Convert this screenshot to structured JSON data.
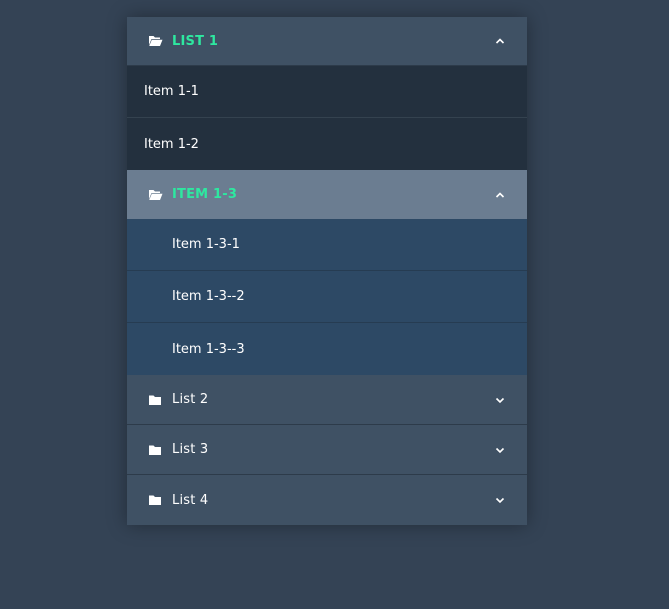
{
  "colors": {
    "background": "#344355",
    "header": "#3f5164",
    "header_active": "#6b7d91",
    "item": "#23303e",
    "subitem": "#2d4965",
    "accent": "#2ee8a0"
  },
  "menu": {
    "list1": {
      "label": "LIST 1",
      "icon": "folder-open-icon",
      "chevron": "chevron-up-icon",
      "items": [
        {
          "label": "Item 1-1"
        },
        {
          "label": "Item 1-2"
        }
      ]
    },
    "list1_3": {
      "label": "ITEM 1-3",
      "icon": "folder-open-icon",
      "chevron": "chevron-up-icon",
      "items": [
        {
          "label": "Item 1-3-1"
        },
        {
          "label": "Item 1-3--2"
        },
        {
          "label": "Item 1-3--3"
        }
      ]
    },
    "list2": {
      "label": "List 2",
      "icon": "folder-icon",
      "chevron": "chevron-down-icon"
    },
    "list3": {
      "label": "List 3",
      "icon": "folder-icon",
      "chevron": "chevron-down-icon"
    },
    "list4": {
      "label": "List 4",
      "icon": "folder-icon",
      "chevron": "chevron-down-icon"
    }
  }
}
